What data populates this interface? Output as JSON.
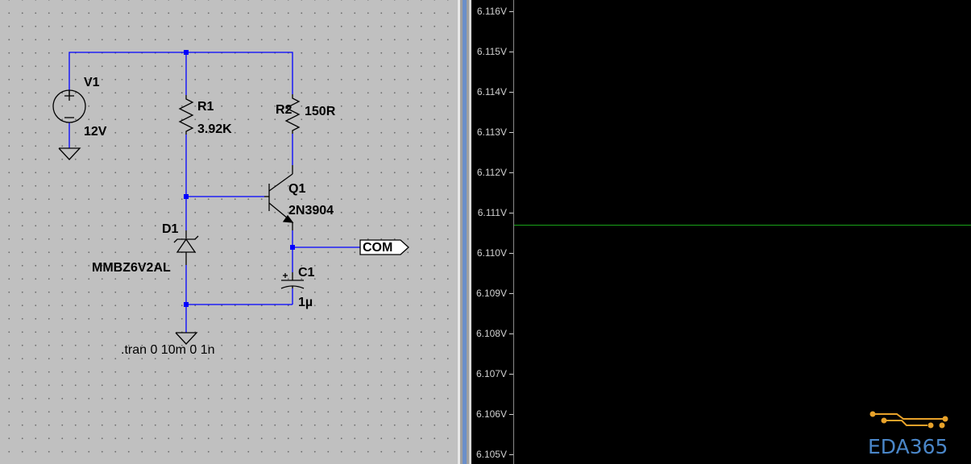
{
  "schematic": {
    "components": {
      "v1": {
        "name": "V1",
        "value": "12V"
      },
      "r1": {
        "name": "R1",
        "value": "3.92K"
      },
      "r2": {
        "name": "R2",
        "value": "150R"
      },
      "q1": {
        "name": "Q1",
        "value": "2N3904"
      },
      "d1": {
        "name": "D1",
        "value": "MMBZ6V2AL"
      },
      "c1": {
        "name": "C1",
        "value": "1µ"
      }
    },
    "net_label": "COM",
    "directive": ".tran 0 10m 0 1n",
    "colors": {
      "wire": "#0000ff",
      "component": "#000000",
      "background": "#c0c0c0"
    }
  },
  "waveform": {
    "y_ticks": [
      "6.116V",
      "6.115V",
      "6.114V",
      "6.113V",
      "6.112V",
      "6.111V",
      "6.110V",
      "6.109V",
      "6.108V",
      "6.107V",
      "6.106V",
      "6.105V"
    ],
    "trace_value_v": 6.1107,
    "trace_color": "#19a319",
    "background": "#000000"
  },
  "watermark": {
    "text": "EDA365"
  }
}
